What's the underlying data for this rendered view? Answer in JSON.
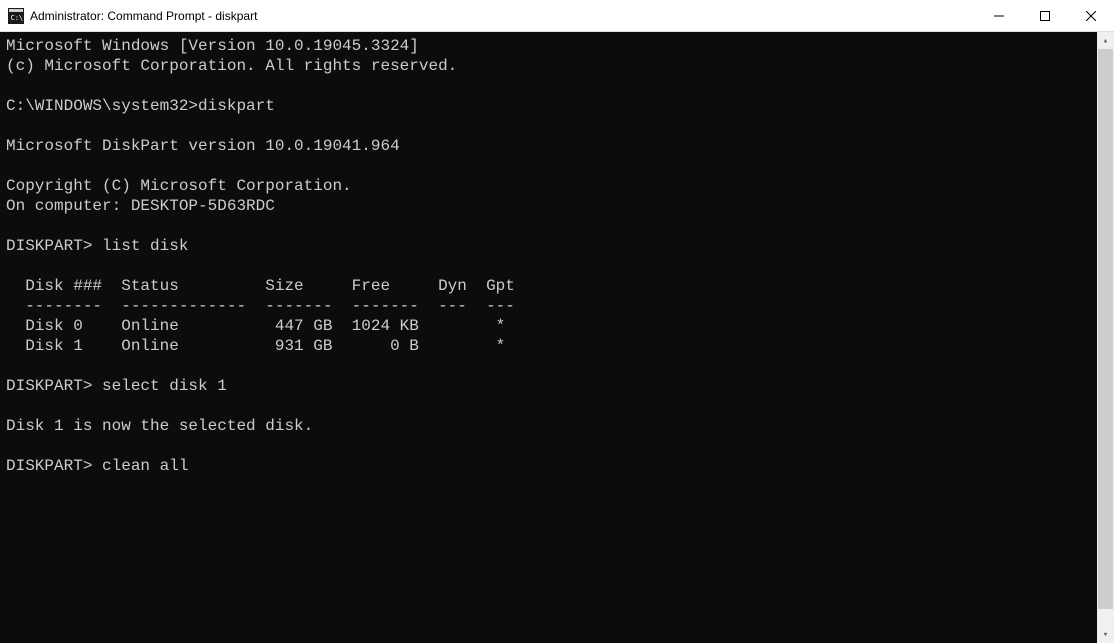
{
  "window": {
    "title": "Administrator: Command Prompt - diskpart"
  },
  "terminal": {
    "line1": "Microsoft Windows [Version 10.0.19045.3324]",
    "line2": "(c) Microsoft Corporation. All rights reserved.",
    "blank1": "",
    "prompt1": "C:\\WINDOWS\\system32>diskpart",
    "blank2": "",
    "dpver": "Microsoft DiskPart version 10.0.19041.964",
    "blank3": "",
    "copyright": "Copyright (C) Microsoft Corporation.",
    "computer": "On computer: DESKTOP-5D63RDC",
    "blank4": "",
    "prompt2": "DISKPART> list disk",
    "blank5": "",
    "header": "  Disk ###  Status         Size     Free     Dyn  Gpt",
    "divider": "  --------  -------------  -------  -------  ---  ---",
    "disk0": "  Disk 0    Online          447 GB  1024 KB        *",
    "disk1": "  Disk 1    Online          931 GB      0 B        *",
    "blank6": "",
    "prompt3": "DISKPART> select disk 1",
    "blank7": "",
    "selected": "Disk 1 is now the selected disk.",
    "blank8": "",
    "prompt4": "DISKPART> clean all"
  }
}
